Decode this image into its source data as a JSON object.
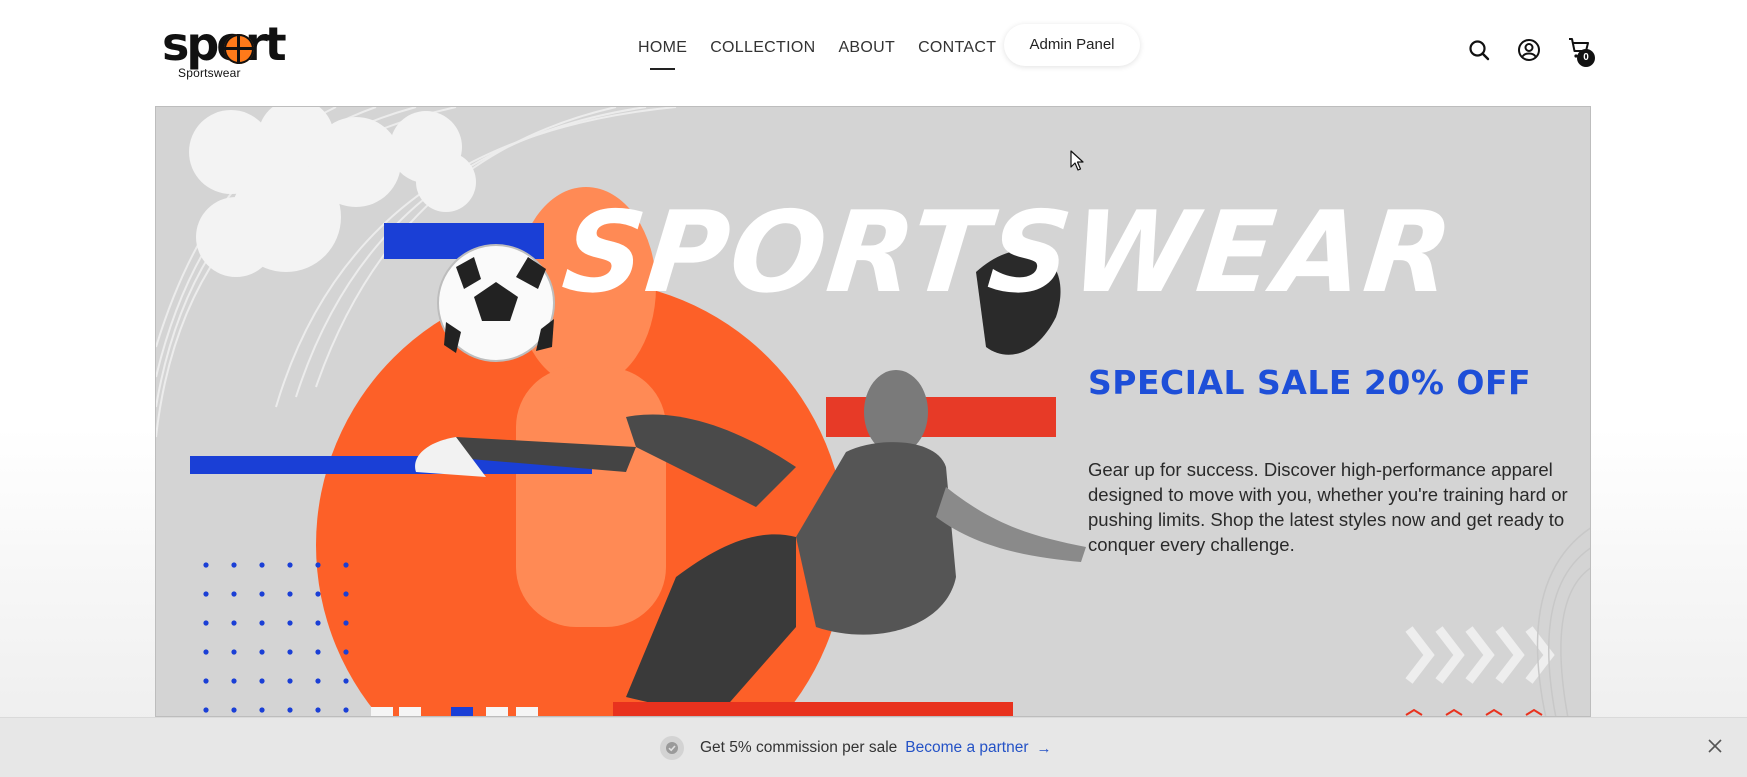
{
  "header": {
    "logo": {
      "word": "sport",
      "sub": "Sportswear"
    },
    "nav": [
      {
        "label": "HOME",
        "active": true
      },
      {
        "label": "COLLECTION",
        "active": false
      },
      {
        "label": "ABOUT",
        "active": false
      },
      {
        "label": "CONTACT",
        "active": false
      }
    ],
    "admin_button": "Admin Panel",
    "icons": {
      "search": "search-icon",
      "account": "user-circle-icon",
      "cart": "cart-icon"
    },
    "cart_count": "0"
  },
  "hero": {
    "title": "SPORTSWEAR",
    "sale": "SPECIAL SALE 20% OFF",
    "description": "Gear up for success. Discover high-performance apparel designed to move with you, whether you're training hard or pushing limits. Shop the latest styles now and get ready to conquer every challenge.",
    "colors": {
      "orange": "#ff5a1f",
      "blue": "#1a3fd6",
      "red": "#e8321e",
      "background": "#d4d4d4"
    }
  },
  "promo_bar": {
    "text": "Get 5% commission per sale",
    "link": "Become a partner",
    "arrow": "→",
    "close_icon": "close-icon"
  }
}
